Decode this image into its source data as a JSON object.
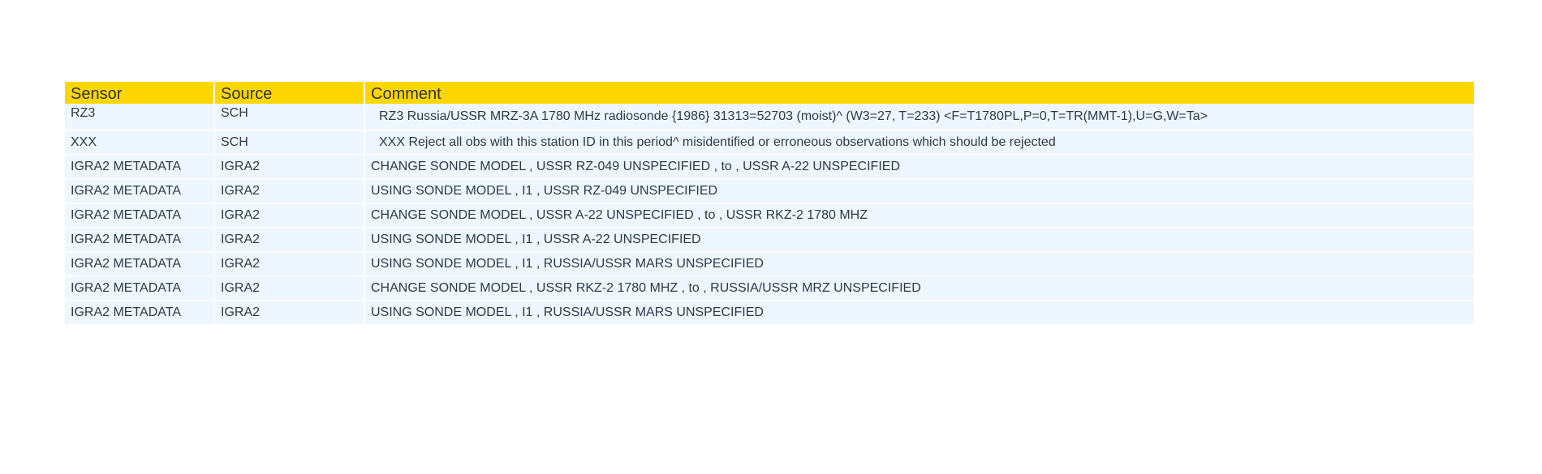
{
  "table": {
    "headers": [
      "Sensor",
      "Source",
      "Comment"
    ],
    "rows": [
      {
        "sensor": "RZ3",
        "source": "SCH",
        "comment": "RZ3 Russia/USSR MRZ-3A 1780 MHz radiosonde {1986} 31313=52703 (moist)^ (W3=27, T=233) <F=T1780PL,P=0,T=TR(MMT-1),U=G,W=Ta>"
      },
      {
        "sensor": "XXX",
        "source": "SCH",
        "comment": "XXX Reject all obs with this station ID in this period^ misidentified or erroneous observations which should be rejected"
      },
      {
        "sensor": "IGRA2 METADATA",
        "source": "IGRA2",
        "comment": "CHANGE SONDE MODEL , USSR RZ-049 UNSPECIFIED , to , USSR A-22 UNSPECIFIED"
      },
      {
        "sensor": "IGRA2 METADATA",
        "source": "IGRA2",
        "comment": "USING SONDE MODEL , I1 , USSR RZ-049 UNSPECIFIED"
      },
      {
        "sensor": "IGRA2 METADATA",
        "source": "IGRA2",
        "comment": "CHANGE SONDE MODEL , USSR A-22 UNSPECIFIED , to , USSR RKZ-2 1780 MHZ"
      },
      {
        "sensor": "IGRA2 METADATA",
        "source": "IGRA2",
        "comment": "USING SONDE MODEL , I1 , USSR A-22 UNSPECIFIED"
      },
      {
        "sensor": "IGRA2 METADATA",
        "source": "IGRA2",
        "comment": "USING SONDE MODEL , I1 , RUSSIA/USSR MARS UNSPECIFIED"
      },
      {
        "sensor": "IGRA2 METADATA",
        "source": "IGRA2",
        "comment": "CHANGE SONDE MODEL , USSR RKZ-2 1780 MHZ , to , RUSSIA/USSR MRZ UNSPECIFIED"
      },
      {
        "sensor": "IGRA2 METADATA",
        "source": "IGRA2",
        "comment": "USING SONDE MODEL , I1 , RUSSIA/USSR MARS UNSPECIFIED"
      }
    ]
  },
  "colors": {
    "header_bg": "#FFD700",
    "row_bg": "#EEF6FF",
    "text": "#2D3A4A"
  }
}
